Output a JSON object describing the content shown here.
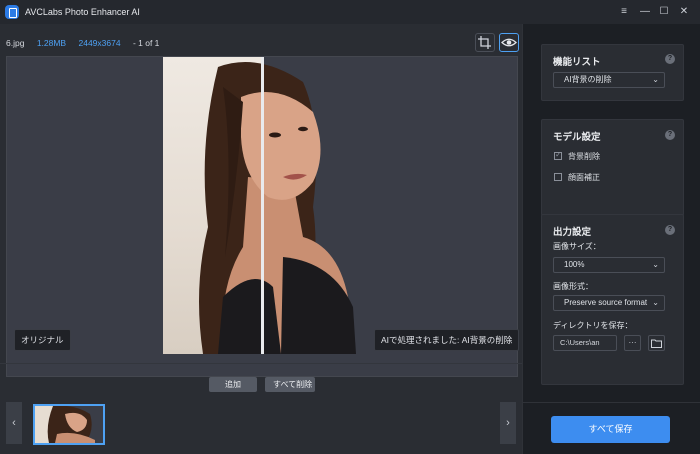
{
  "app": {
    "title": "AVCLabs Photo Enhancer AI",
    "icon": "app-logo-icon",
    "window_controls": {
      "menu": "≡",
      "minimize": "—",
      "maximize": "☐",
      "close": "✕"
    }
  },
  "file_info": {
    "name": "6.jpg",
    "size": "1.28MB",
    "dimensions": "2449x3674",
    "count": "- 1 of 1"
  },
  "preview": {
    "label_original": "オリジナル",
    "label_processed": "AIで処理されました: AI背景の削除"
  },
  "actions": {
    "add": "追加",
    "clear_all": "すべて削除"
  },
  "side": {
    "feature_list": {
      "title": "機能リスト",
      "selected": "AI背景の削除"
    },
    "model_settings": {
      "title": "モデル設定",
      "options": [
        {
          "label": "背景削除",
          "checked": true
        },
        {
          "label": "顔面補正",
          "checked": false
        }
      ]
    },
    "output_settings": {
      "title": "出力設定",
      "image_size_label": "画像サイズ：",
      "image_size_value": "100%",
      "image_format_label": "画像形式：",
      "image_format_value": "Preserve source format",
      "directory_label": "ディレクトリを保存：",
      "directory_value": "C:\\Users\\an",
      "browse": "···"
    },
    "save_all": "すべて保存"
  },
  "colors": {
    "accent": "#3d8df0",
    "info_blue": "#4ea1f3",
    "panel_bg": "#2a2d33"
  }
}
